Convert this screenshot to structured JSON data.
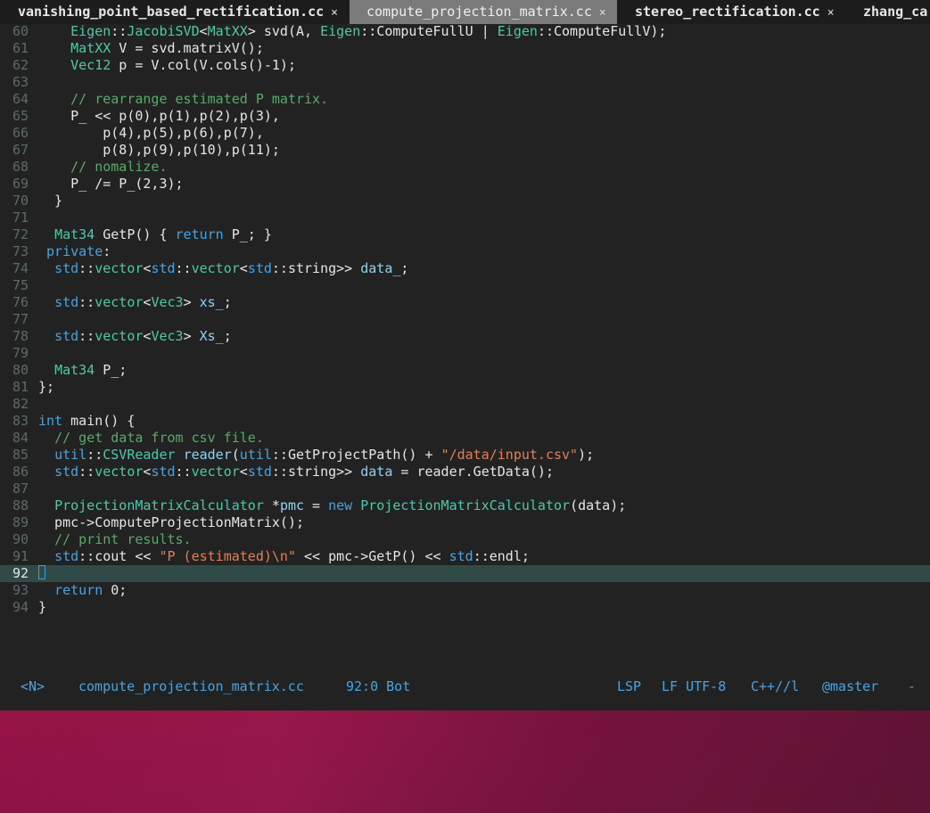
{
  "tabs": [
    {
      "label": "vanishing_point_based_rectification.cc",
      "close": "×",
      "active": false
    },
    {
      "label": "compute_projection_matrix.cc",
      "close": "×",
      "active": true
    },
    {
      "label": "stereo_rectification.cc",
      "close": "×",
      "active": false
    },
    {
      "label": "zhang_ca",
      "close": "",
      "active": false
    }
  ],
  "status": {
    "mode": "<N>",
    "filename": "compute_projection_matrix.cc",
    "position": "92:0 Bot",
    "lsp": "LSP",
    "format": "LF UTF-8",
    "filetype": "C++//l",
    "branch": "@master",
    "tail": "-"
  },
  "code": [
    {
      "n": "60",
      "html": "    <span class=\"ty\">Eigen</span>::<span class=\"ty\">JacobiSVD</span><<span class=\"ty\">MatXX</span>> svd(A, <span class=\"ty\">Eigen</span>::ComputeFullU | <span class=\"ty\">Eigen</span>::ComputeFullV);"
    },
    {
      "n": "61",
      "html": "    <span class=\"ty\">MatXX</span> V = svd.matrixV();"
    },
    {
      "n": "62",
      "html": "    <span class=\"ty\">Vec12</span> p = V.col(V.cols()-1);"
    },
    {
      "n": "63",
      "html": ""
    },
    {
      "n": "64",
      "html": "    <span class=\"cm\">// rearrange estimated P matrix.</span>"
    },
    {
      "n": "65",
      "html": "    P_ << p(0),p(1),p(2),p(3),"
    },
    {
      "n": "66",
      "html": "        p(4),p(5),p(6),p(7),"
    },
    {
      "n": "67",
      "html": "        p(8),p(9),p(10),p(11);"
    },
    {
      "n": "68",
      "html": "    <span class=\"cm\">// nomalize.</span>"
    },
    {
      "n": "69",
      "html": "    P_ /= P_(2,3);"
    },
    {
      "n": "70",
      "html": "  }"
    },
    {
      "n": "71",
      "html": ""
    },
    {
      "n": "72",
      "html": "  <span class=\"ty\">Mat34</span> GetP() { <span class=\"kw\">return</span> P_; }"
    },
    {
      "n": "73",
      "html": " <span class=\"kw\">private</span>:"
    },
    {
      "n": "74",
      "html": "  <span class=\"kw\">std</span>::<span class=\"ty\">vector</span><<span class=\"kw\">std</span>::<span class=\"ty\">vector</span><<span class=\"kw\">std</span>::string>> <span class=\"vr\">data_</span>;"
    },
    {
      "n": "75",
      "html": ""
    },
    {
      "n": "76",
      "html": "  <span class=\"kw\">std</span>::<span class=\"ty\">vector</span><<span class=\"ty\">Vec3</span>> <span class=\"vr\">xs_</span>;"
    },
    {
      "n": "77",
      "html": ""
    },
    {
      "n": "78",
      "html": "  <span class=\"kw\">std</span>::<span class=\"ty\">vector</span><<span class=\"ty\">Vec3</span>> <span class=\"vr\">Xs_</span>;"
    },
    {
      "n": "79",
      "html": ""
    },
    {
      "n": "80",
      "html": "  <span class=\"ty\">Mat34</span> P_;"
    },
    {
      "n": "81",
      "html": "};"
    },
    {
      "n": "82",
      "html": ""
    },
    {
      "n": "83",
      "html": "<span class=\"kw\">int</span> main() {"
    },
    {
      "n": "84",
      "html": "  <span class=\"cm\">// get data from csv file.</span>"
    },
    {
      "n": "85",
      "html": "  <span class=\"kw\">util</span>::<span class=\"ty\">CSVReader</span> <span class=\"vr\">reader</span>(<span class=\"kw\">util</span>::GetProjectPath() + <span class=\"st\">\"/data/input.csv\"</span>);"
    },
    {
      "n": "86",
      "html": "  <span class=\"kw\">std</span>::<span class=\"ty\">vector</span><<span class=\"kw\">std</span>::<span class=\"ty\">vector</span><<span class=\"kw\">std</span>::string>> <span class=\"vr\">data</span> = reader.GetData();"
    },
    {
      "n": "87",
      "html": ""
    },
    {
      "n": "88",
      "html": "  <span class=\"ty\">ProjectionMatrixCalculator</span> *<span class=\"vr\">pmc</span> = <span class=\"kw\">new</span> <span class=\"ty\">ProjectionMatrixCalculator</span>(data);"
    },
    {
      "n": "89",
      "html": "  pmc->ComputeProjectionMatrix();"
    },
    {
      "n": "90",
      "html": "  <span class=\"cm\">// print results.</span>"
    },
    {
      "n": "91",
      "html": "  <span class=\"kw\">std</span>::cout << <span class=\"st\">\"P (estimated)\\n\"</span> << pmc->GetP() << <span class=\"kw\">std</span>::endl;"
    },
    {
      "n": "92",
      "html": "<span class=\"cursor\" data-name=\"text-cursor\"></span>",
      "current": true
    },
    {
      "n": "93",
      "html": "  <span class=\"kw\">return</span> 0;"
    },
    {
      "n": "94",
      "html": "}"
    }
  ]
}
